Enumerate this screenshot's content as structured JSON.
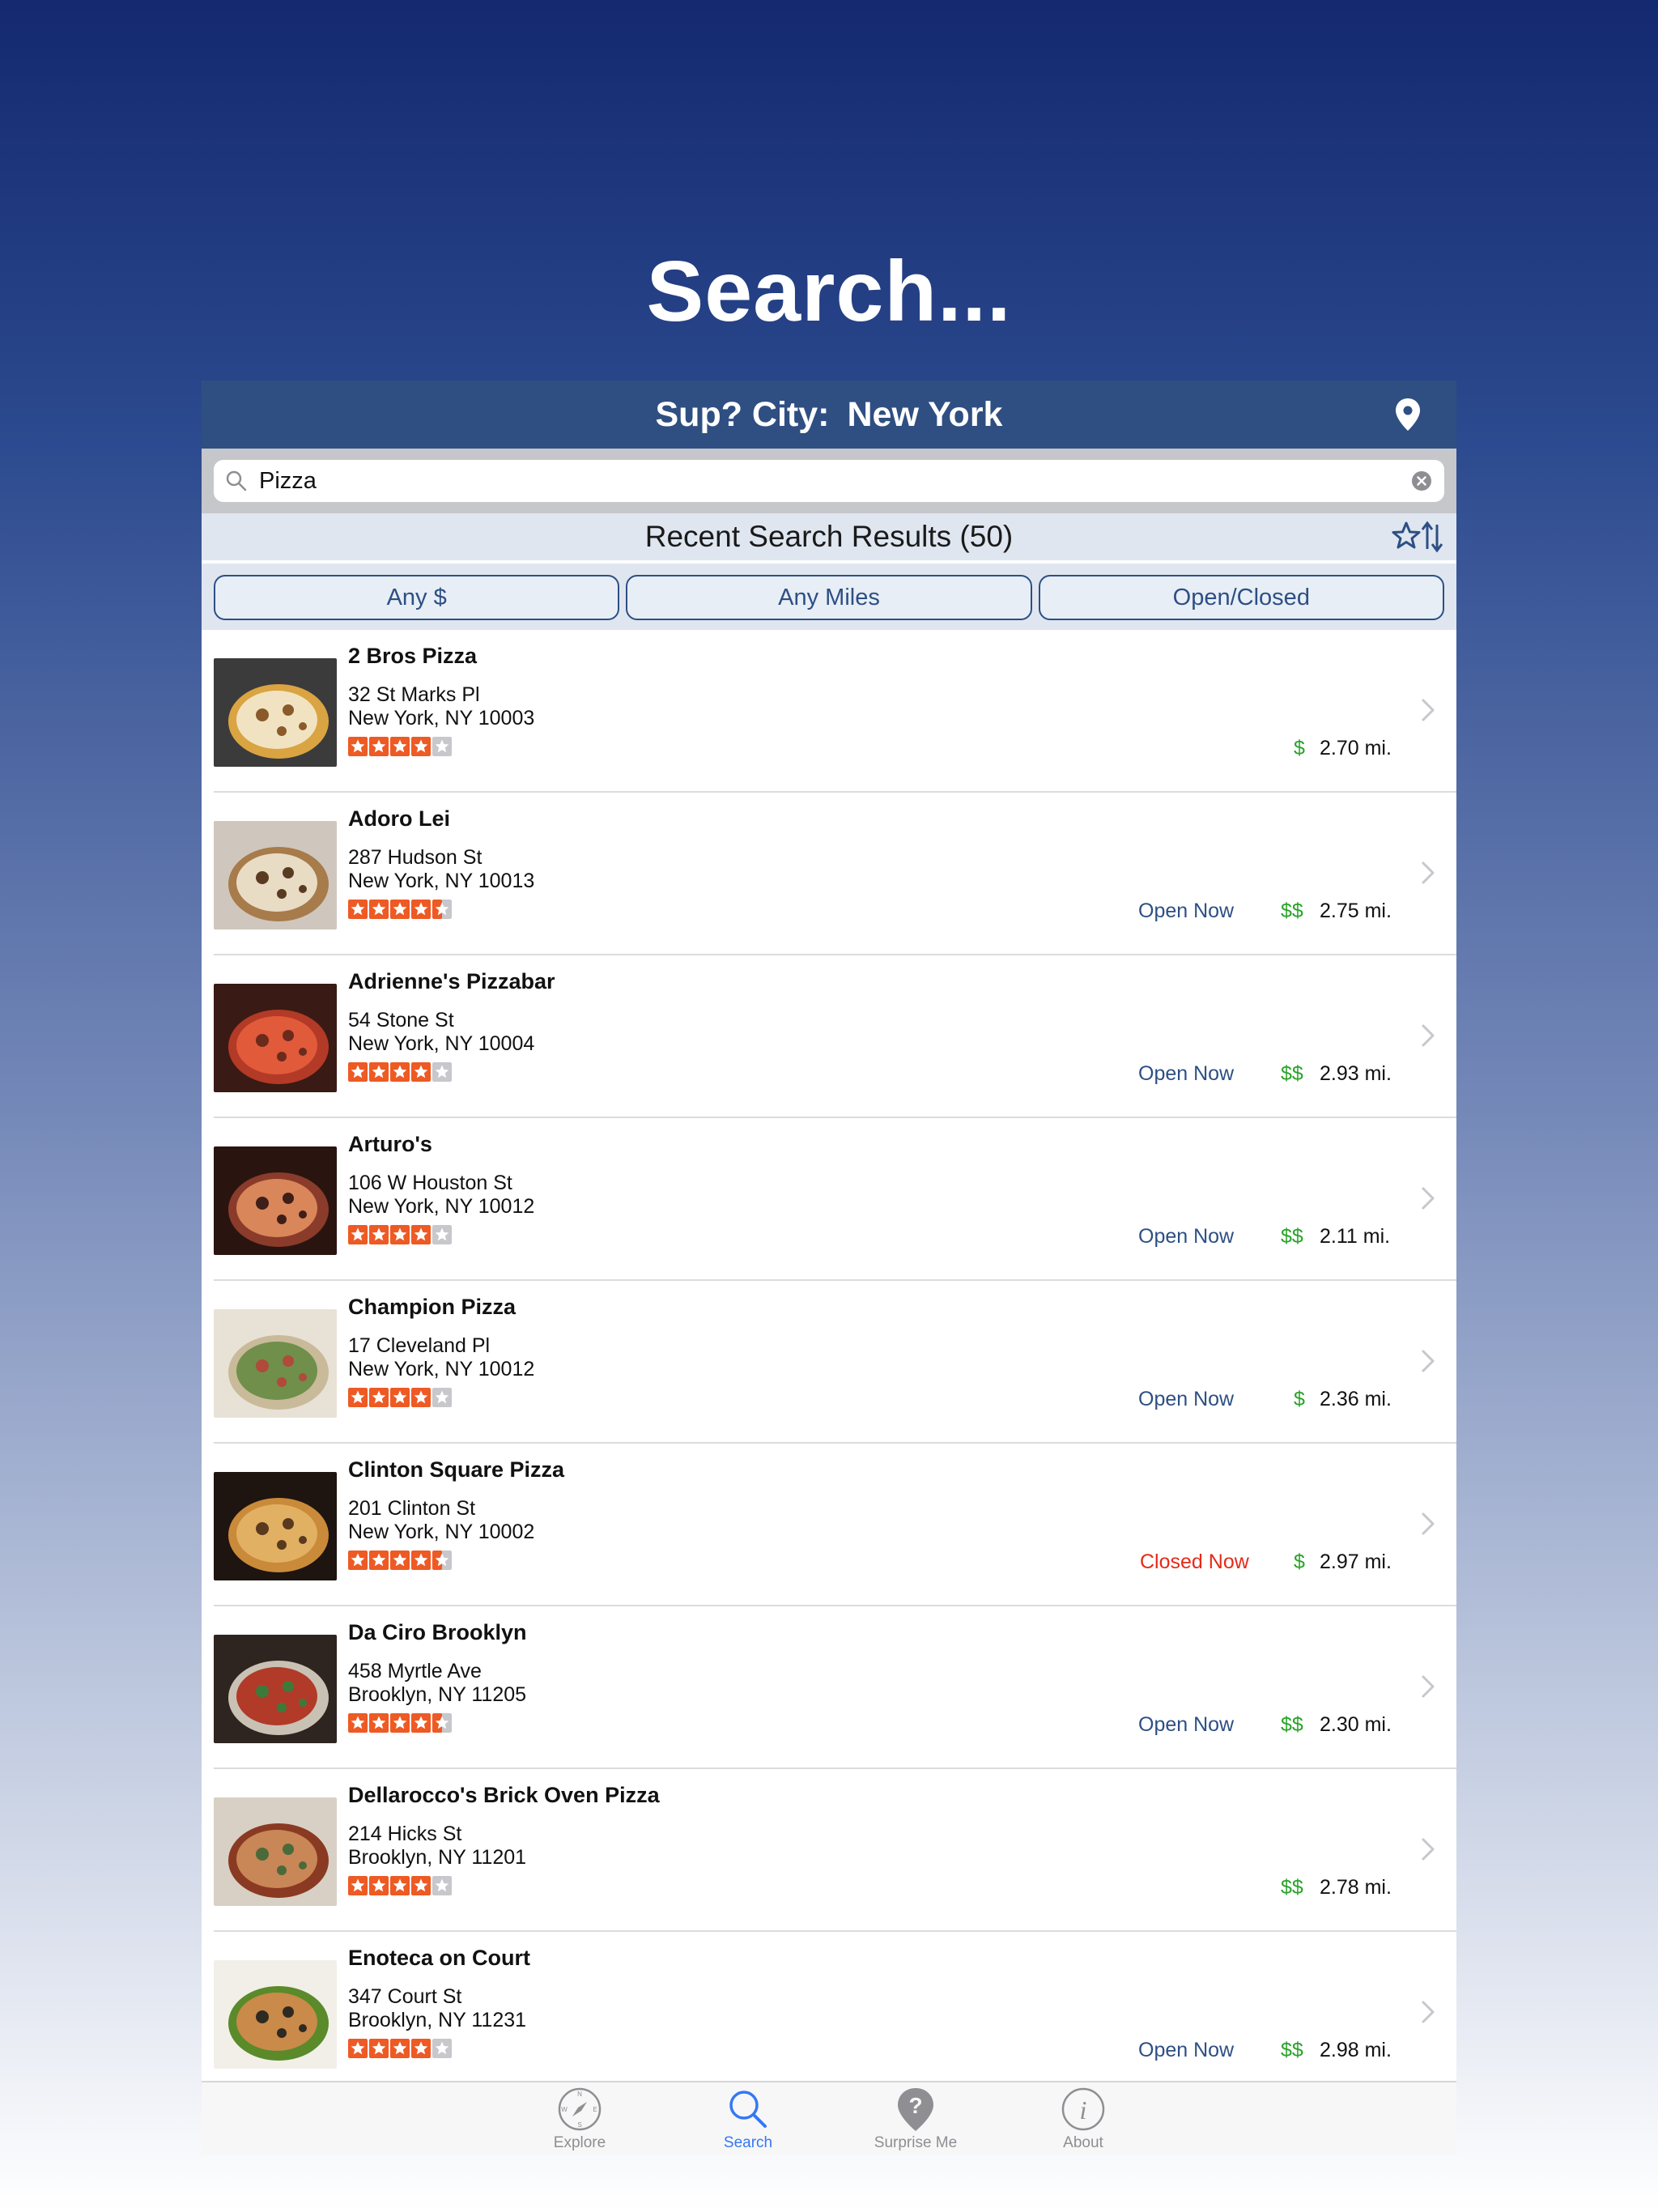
{
  "headline": "Search...",
  "navbar": {
    "city_label": "Sup? City:",
    "city_value": "New York"
  },
  "search": {
    "query": "Pizza"
  },
  "results_header": "Recent Search Results (50)",
  "filters": [
    "Any $",
    "Any Miles",
    "Open/Closed"
  ],
  "status_colors": {
    "open": "#2d4f84",
    "closed": "#e52a18",
    "price": "#29a329",
    "star": "#ee5a24"
  },
  "results": [
    {
      "name": "2 Bros Pizza",
      "address1": "32 St Marks Pl",
      "address2": "New York, NY 10003",
      "rating": 4,
      "status": "",
      "price": "$",
      "distance": "2.70 mi."
    },
    {
      "name": "Adoro Lei",
      "address1": "287 Hudson St",
      "address2": "New York, NY 10013",
      "rating": 4.5,
      "status": "Open Now",
      "price": "$$",
      "distance": "2.75 mi."
    },
    {
      "name": "Adrienne's Pizzabar",
      "address1": "54 Stone St",
      "address2": "New York, NY 10004",
      "rating": 4,
      "status": "Open Now",
      "price": "$$",
      "distance": "2.93 mi."
    },
    {
      "name": "Arturo's",
      "address1": "106 W Houston St",
      "address2": "New York, NY 10012",
      "rating": 4,
      "status": "Open Now",
      "price": "$$",
      "distance": "2.11 mi."
    },
    {
      "name": "Champion Pizza",
      "address1": "17 Cleveland Pl",
      "address2": "New York, NY 10012",
      "rating": 4,
      "status": "Open Now",
      "price": "$",
      "distance": "2.36 mi."
    },
    {
      "name": "Clinton Square Pizza",
      "address1": "201 Clinton St",
      "address2": "New York, NY 10002",
      "rating": 4.5,
      "status": "Closed Now",
      "price": "$",
      "distance": "2.97 mi."
    },
    {
      "name": "Da Ciro Brooklyn",
      "address1": "458 Myrtle Ave",
      "address2": "Brooklyn, NY 11205",
      "rating": 4.5,
      "status": "Open Now",
      "price": "$$",
      "distance": "2.30 mi."
    },
    {
      "name": "Dellarocco's Brick Oven Pizza",
      "address1": "214 Hicks St",
      "address2": "Brooklyn, NY 11201",
      "rating": 4,
      "status": "",
      "price": "$$",
      "distance": "2.78 mi."
    },
    {
      "name": "Enoteca on Court",
      "address1": "347 Court St",
      "address2": "Brooklyn, NY 11231",
      "rating": 4,
      "status": "Open Now",
      "price": "$$",
      "distance": "2.98 mi."
    }
  ],
  "tabs": [
    {
      "label": "Explore",
      "icon": "compass-icon",
      "active": false
    },
    {
      "label": "Search",
      "icon": "search-icon",
      "active": true
    },
    {
      "label": "Surprise Me",
      "icon": "question-pin-icon",
      "active": false
    },
    {
      "label": "About",
      "icon": "info-icon",
      "active": false
    }
  ]
}
